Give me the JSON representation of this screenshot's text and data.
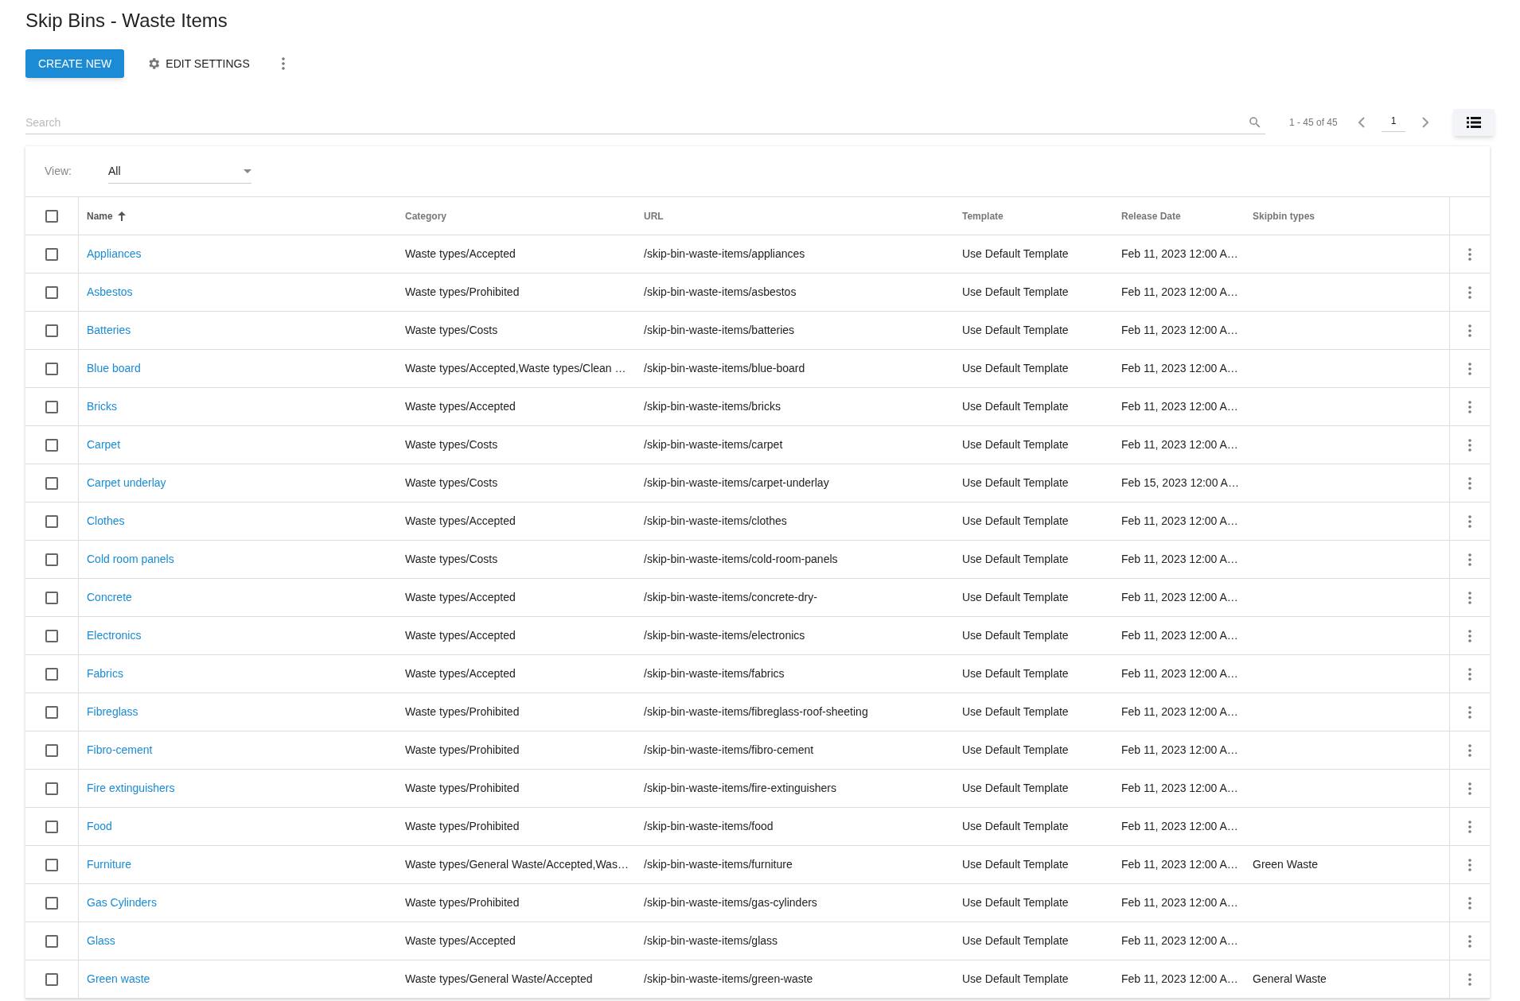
{
  "page_title": "Skip Bins - Waste Items",
  "toolbar": {
    "create_button": "CREATE NEW",
    "settings_button": "EDIT SETTINGS"
  },
  "search": {
    "placeholder": "Search"
  },
  "pagination": {
    "range": "1 - 45 of 45",
    "page": "1"
  },
  "view_filter": {
    "label": "View:",
    "value": "All"
  },
  "table": {
    "select_all_checked": false,
    "columns": [
      {
        "label": "Name",
        "sorted": true
      },
      {
        "label": "Category",
        "sorted": false
      },
      {
        "label": "URL",
        "sorted": false
      },
      {
        "label": "Template",
        "sorted": false
      },
      {
        "label": "Release Date",
        "sorted": false
      },
      {
        "label": "Skipbin types",
        "sorted": false
      }
    ],
    "rows": [
      {
        "name": "Appliances",
        "category": "Waste types/Accepted",
        "url": "/skip-bin-waste-items/appliances",
        "template": "Use Default Template",
        "release_date": "Feb 11, 2023 12:00 A…",
        "skipbin_types": "",
        "checked": false
      },
      {
        "name": "Asbestos",
        "category": "Waste types/Prohibited",
        "url": "/skip-bin-waste-items/asbestos",
        "template": "Use Default Template",
        "release_date": "Feb 11, 2023 12:00 A…",
        "skipbin_types": "",
        "checked": false
      },
      {
        "name": "Batteries",
        "category": "Waste types/Costs",
        "url": "/skip-bin-waste-items/batteries",
        "template": "Use Default Template",
        "release_date": "Feb 11, 2023 12:00 A…",
        "skipbin_types": "",
        "checked": false
      },
      {
        "name": "Blue board",
        "category": "Waste types/Accepted,Waste types/Clean …",
        "url": "/skip-bin-waste-items/blue-board",
        "template": "Use Default Template",
        "release_date": "Feb 11, 2023 12:00 A…",
        "skipbin_types": "",
        "checked": false
      },
      {
        "name": "Bricks",
        "category": "Waste types/Accepted",
        "url": "/skip-bin-waste-items/bricks",
        "template": "Use Default Template",
        "release_date": "Feb 11, 2023 12:00 A…",
        "skipbin_types": "",
        "checked": false
      },
      {
        "name": "Carpet",
        "category": "Waste types/Costs",
        "url": "/skip-bin-waste-items/carpet",
        "template": "Use Default Template",
        "release_date": "Feb 11, 2023 12:00 A…",
        "skipbin_types": "",
        "checked": false
      },
      {
        "name": "Carpet underlay",
        "category": "Waste types/Costs",
        "url": "/skip-bin-waste-items/carpet-underlay",
        "template": "Use Default Template",
        "release_date": "Feb 15, 2023 12:00 A…",
        "skipbin_types": "",
        "checked": false
      },
      {
        "name": "Clothes",
        "category": "Waste types/Accepted",
        "url": "/skip-bin-waste-items/clothes",
        "template": "Use Default Template",
        "release_date": "Feb 11, 2023 12:00 A…",
        "skipbin_types": "",
        "checked": false
      },
      {
        "name": "Cold room panels",
        "category": "Waste types/Costs",
        "url": "/skip-bin-waste-items/cold-room-panels",
        "template": "Use Default Template",
        "release_date": "Feb 11, 2023 12:00 A…",
        "skipbin_types": "",
        "checked": false
      },
      {
        "name": "Concrete",
        "category": "Waste types/Accepted",
        "url": "/skip-bin-waste-items/concrete-dry-",
        "template": "Use Default Template",
        "release_date": "Feb 11, 2023 12:00 A…",
        "skipbin_types": "",
        "checked": false
      },
      {
        "name": "Electronics",
        "category": "Waste types/Accepted",
        "url": "/skip-bin-waste-items/electronics",
        "template": "Use Default Template",
        "release_date": "Feb 11, 2023 12:00 A…",
        "skipbin_types": "",
        "checked": false
      },
      {
        "name": "Fabrics",
        "category": "Waste types/Accepted",
        "url": "/skip-bin-waste-items/fabrics",
        "template": "Use Default Template",
        "release_date": "Feb 11, 2023 12:00 A…",
        "skipbin_types": "",
        "checked": false
      },
      {
        "name": "Fibreglass",
        "category": "Waste types/Prohibited",
        "url": "/skip-bin-waste-items/fibreglass-roof-sheeting",
        "template": "Use Default Template",
        "release_date": "Feb 11, 2023 12:00 A…",
        "skipbin_types": "",
        "checked": false
      },
      {
        "name": "Fibro-cement",
        "category": "Waste types/Prohibited",
        "url": "/skip-bin-waste-items/fibro-cement",
        "template": "Use Default Template",
        "release_date": "Feb 11, 2023 12:00 A…",
        "skipbin_types": "",
        "checked": false
      },
      {
        "name": "Fire extinguishers",
        "category": "Waste types/Prohibited",
        "url": "/skip-bin-waste-items/fire-extinguishers",
        "template": "Use Default Template",
        "release_date": "Feb 11, 2023 12:00 A…",
        "skipbin_types": "",
        "checked": false
      },
      {
        "name": "Food",
        "category": "Waste types/Prohibited",
        "url": "/skip-bin-waste-items/food",
        "template": "Use Default Template",
        "release_date": "Feb 11, 2023 12:00 A…",
        "skipbin_types": "",
        "checked": false
      },
      {
        "name": "Furniture",
        "category": "Waste types/General Waste/Accepted,Was…",
        "url": "/skip-bin-waste-items/furniture",
        "template": "Use Default Template",
        "release_date": "Feb 11, 2023 12:00 A…",
        "skipbin_types": "Green Waste",
        "checked": false
      },
      {
        "name": "Gas Cylinders",
        "category": "Waste types/Prohibited",
        "url": "/skip-bin-waste-items/gas-cylinders",
        "template": "Use Default Template",
        "release_date": "Feb 11, 2023 12:00 A…",
        "skipbin_types": "",
        "checked": false
      },
      {
        "name": "Glass",
        "category": "Waste types/Accepted",
        "url": "/skip-bin-waste-items/glass",
        "template": "Use Default Template",
        "release_date": "Feb 11, 2023 12:00 A…",
        "skipbin_types": "",
        "checked": false
      },
      {
        "name": "Green waste",
        "category": "Waste types/General Waste/Accepted",
        "url": "/skip-bin-waste-items/green-waste",
        "template": "Use Default Template",
        "release_date": "Feb 11, 2023 12:00 A…",
        "skipbin_types": "General Waste",
        "checked": false
      }
    ]
  }
}
